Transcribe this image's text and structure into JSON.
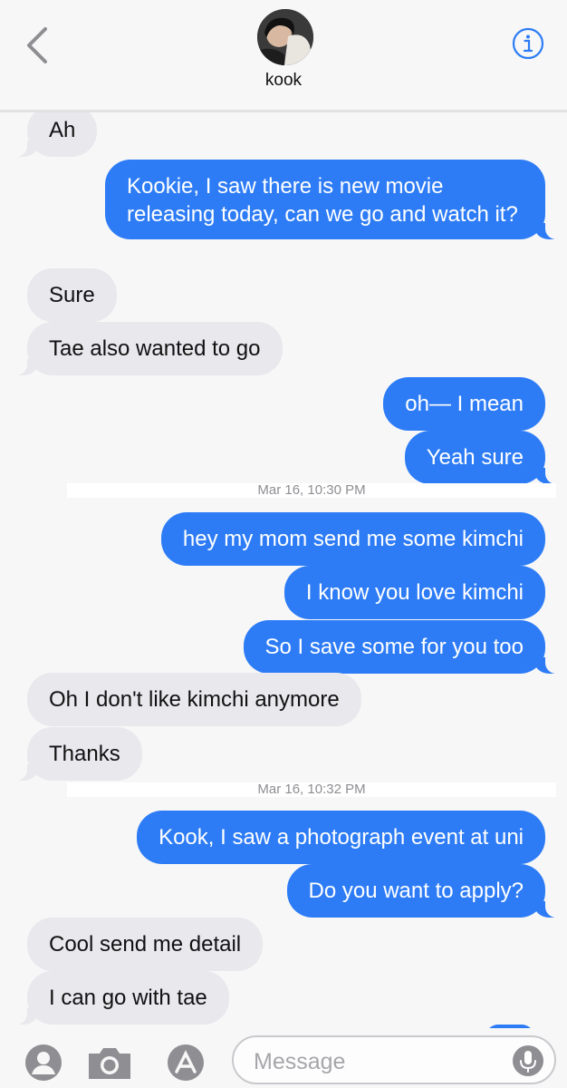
{
  "header": {
    "contact_name": "kook"
  },
  "messages": [
    {
      "side": "in",
      "text": "Ah"
    },
    {
      "side": "out",
      "text": "Kookie, I saw there is new movie releasing today, can we go and watch it?"
    },
    {
      "side": "in",
      "text": "Sure"
    },
    {
      "side": "in",
      "text": "Tae also wanted to go"
    },
    {
      "side": "out",
      "text": "oh— I mean"
    },
    {
      "side": "out",
      "text": "Yeah sure"
    },
    {
      "side": "out",
      "text": "hey my mom send me some kimchi"
    },
    {
      "side": "out",
      "text": "I know you love kimchi"
    },
    {
      "side": "out",
      "text": "So I save some for you too"
    },
    {
      "side": "in",
      "text": "Oh I don't like kimchi anymore"
    },
    {
      "side": "in",
      "text": "Thanks"
    },
    {
      "side": "out",
      "text": "Kook, I saw a photograph event at uni"
    },
    {
      "side": "out",
      "text": "Do you want to apply?"
    },
    {
      "side": "in",
      "text": "Cool send me detail"
    },
    {
      "side": "in",
      "text": "I can go with tae"
    }
  ],
  "timestamps": [
    "Mar 16, 10:30 PM",
    "Mar 16, 10:32 PM"
  ],
  "input": {
    "placeholder": "Message"
  },
  "colors": {
    "outgoing_bubble": "#2d7cf6",
    "incoming_bubble": "#e8e8ed",
    "accent": "#2d7cf6"
  },
  "icons": [
    "back-chevron-icon",
    "info-icon",
    "contacts-icon",
    "camera-icon",
    "app-store-icon",
    "microphone-icon"
  ]
}
